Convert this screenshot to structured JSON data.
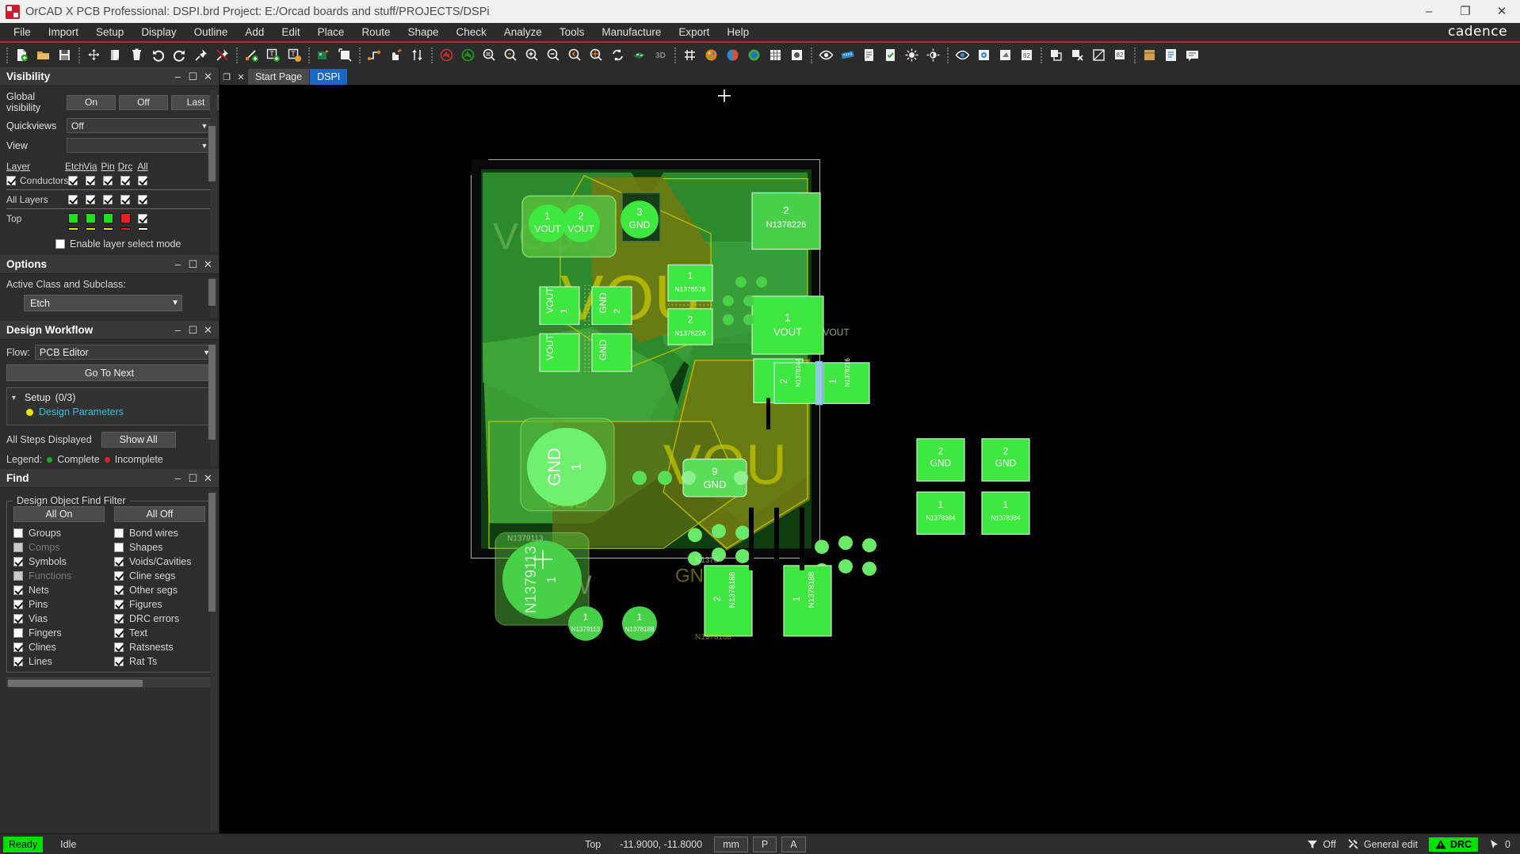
{
  "titlebar": {
    "logo_icon": "cadence-app-icon",
    "text": "OrCAD X PCB Professional: DSPI.brd  Project: E:/Orcad boards and stuff/PROJECTS/DSPi",
    "minimize": "–",
    "maximize": "❐",
    "close": "✕"
  },
  "menubar": {
    "items": [
      "File",
      "Import",
      "Setup",
      "Display",
      "Outline",
      "Add",
      "Edit",
      "Place",
      "Route",
      "Shape",
      "Check",
      "Analyze",
      "Tools",
      "Manufacture",
      "Export",
      "Help"
    ],
    "brand": "cadence"
  },
  "toolbar": {
    "groups": [
      [
        "new-file-icon",
        "open-folder-icon",
        "save-icon"
      ],
      [
        "move-icon",
        "copy-icon",
        "delete-icon",
        "undo-icon",
        "redo-icon",
        "pin-icon",
        "unpin-icon"
      ],
      [
        "add-line-icon",
        "add-text-icon",
        "edit-text-icon"
      ],
      [
        "place-component-icon",
        "place-symbol-icon"
      ],
      [
        "net-schedule-icon",
        "slide-icon",
        "swap-icon"
      ],
      [
        "ratsnest-off-icon",
        "ratsnest-on-icon",
        "zoom-fit-icon",
        "zoom-by-points-icon",
        "zoom-in-icon",
        "zoom-out-icon",
        "zoom-previous-icon",
        "zoom-center-icon",
        "refresh-icon",
        "board-3d-icon",
        "view-3d-icon"
      ],
      [
        "grid-toggle-icon",
        "color-palette-icon",
        "color-wheel-icon",
        "layer-colors-icon",
        "spreadsheet-icon",
        "settings-icon"
      ],
      [
        "show-element-icon",
        "measure-icon",
        "report-icon",
        "drc-check-icon",
        "brightness-icon",
        "contrast-icon"
      ],
      [
        "constraint-manager-icon",
        "padstack-icon",
        "symbol-edit-icon",
        "net-logic-icon"
      ],
      [
        "cut-section-icon",
        "delete-section-icon",
        "dimension-icon",
        "label-icon"
      ],
      [
        "library-icon",
        "datasheet-icon",
        "notes-icon"
      ]
    ]
  },
  "visibility": {
    "panel_title": "Visibility",
    "global_visibility_label": "Global visibility",
    "global_buttons": [
      "On",
      "Off",
      "Last"
    ],
    "quickviews_label": "Quickviews",
    "quickviews_value": "Off",
    "view_label": "View",
    "view_value": "",
    "columns": [
      "Etch",
      "Via",
      "Pin",
      "Drc",
      "All"
    ],
    "layer_header": "Layer",
    "rows": [
      {
        "name": "Conductors",
        "has_checkbox": true,
        "checked": true,
        "cells": [
          "check",
          "check",
          "check",
          "check",
          "check"
        ]
      },
      {
        "name": "All Layers",
        "has_checkbox": false,
        "checked": false,
        "cells": [
          "check",
          "check",
          "check",
          "check",
          "check"
        ]
      },
      {
        "name": "Top",
        "has_checkbox": false,
        "checked": false,
        "cells": [
          "swatch",
          "swatch",
          "swatch",
          "swatch",
          "check"
        ]
      }
    ],
    "top_swatch_colors": [
      "#1ee01e",
      "#1ee01e",
      "#1ee01e",
      "#e82020"
    ],
    "partial_swatch_colors": [
      "#e8e800",
      "#e8e800",
      "#e8e800",
      "#e82020",
      "#ffffff"
    ],
    "enable_layer_select_label": "Enable layer select mode",
    "enable_layer_select_checked": false
  },
  "options": {
    "panel_title": "Options",
    "active_class_label": "Active Class and Subclass:",
    "active_class_value": "Etch"
  },
  "workflow": {
    "panel_title": "Design Workflow",
    "flow_label": "Flow:",
    "flow_value": "PCB Editor",
    "go_to_next": "Go To Next",
    "group_name": "Setup",
    "group_progress": "(0/3)",
    "step_label": "Design Parameters",
    "step_dot_color": "#f0e000",
    "all_steps_label": "All Steps Displayed",
    "show_all": "Show All",
    "legend_label": "Legend:",
    "legend_complete": "Complete",
    "legend_complete_color": "#22aa22",
    "legend_incomplete": "Incomplete",
    "legend_incomplete_color": "#dd2222"
  },
  "find": {
    "panel_title": "Find",
    "fieldset_legend": "Design Object Find Filter",
    "all_on": "All On",
    "all_off": "All Off",
    "items": [
      {
        "label": "Groups",
        "checked": false,
        "disabled": false
      },
      {
        "label": "Bond wires",
        "checked": false,
        "disabled": false
      },
      {
        "label": "Comps",
        "checked": false,
        "disabled": true
      },
      {
        "label": "Shapes",
        "checked": false,
        "disabled": false
      },
      {
        "label": "Symbols",
        "checked": true,
        "disabled": false
      },
      {
        "label": "Voids/Cavities",
        "checked": true,
        "disabled": false
      },
      {
        "label": "Functions",
        "checked": false,
        "disabled": true
      },
      {
        "label": "Cline segs",
        "checked": true,
        "disabled": false
      },
      {
        "label": "Nets",
        "checked": true,
        "disabled": false
      },
      {
        "label": "Other segs",
        "checked": true,
        "disabled": false
      },
      {
        "label": "Pins",
        "checked": true,
        "disabled": false
      },
      {
        "label": "Figures",
        "checked": true,
        "disabled": false
      },
      {
        "label": "Vias",
        "checked": true,
        "disabled": false
      },
      {
        "label": "DRC errors",
        "checked": true,
        "disabled": false
      },
      {
        "label": "Fingers",
        "checked": false,
        "disabled": false
      },
      {
        "label": "Text",
        "checked": true,
        "disabled": false
      },
      {
        "label": "Clines",
        "checked": true,
        "disabled": false
      },
      {
        "label": "Ratsnests",
        "checked": true,
        "disabled": false
      },
      {
        "label": "Lines",
        "checked": true,
        "disabled": false
      },
      {
        "label": "Rat Ts",
        "checked": true,
        "disabled": false
      }
    ]
  },
  "tabs": {
    "restore_icon": "restore-window-icon",
    "close_icon": "close-tab-icon",
    "items": [
      {
        "label": "Start Page",
        "active": false
      },
      {
        "label": "DSPI",
        "active": true
      }
    ]
  },
  "canvas": {
    "background": "#000000",
    "crosshair_color": "#ffffff",
    "board_outline_color": "#d8d8d8",
    "copper_fill": "#2f8f2f",
    "copper_light": "#4fc24f",
    "pad_green": "#3ee83e",
    "silk_yellow": "#c8c800",
    "labels": [
      "VOUT",
      "GND",
      "SW",
      "N1378226",
      "N1378578",
      "N1379113",
      "N1378188",
      "N1378384",
      "N1378244",
      "N1378216",
      "N1378186"
    ],
    "big_silk": [
      "VOUT",
      "VOUT",
      "GND",
      "SW"
    ]
  },
  "statusbar": {
    "ready": "Ready",
    "idle": "Idle",
    "layer": "Top",
    "coords": "-11.9000, -11.8000",
    "units": "mm",
    "mode_p": "P",
    "mode_a": "A",
    "filter_icon": "funnel-icon",
    "filter_value": "Off",
    "tools_icon": "tools-icon",
    "tools_value": "General edit",
    "drc_icon": "warning-triangle-icon",
    "drc_label": "DRC",
    "drc_color": "#00e000",
    "cursor_icon": "cursor-arrow-icon",
    "cursor_count": "0"
  }
}
